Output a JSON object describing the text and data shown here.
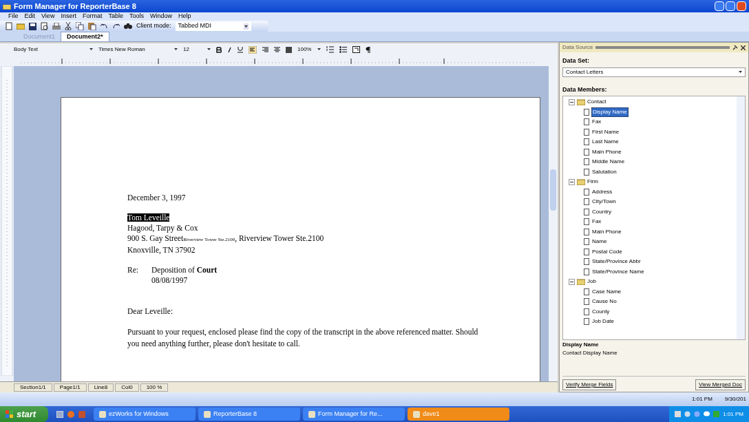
{
  "window": {
    "title": "Form Manager for ReporterBase 8"
  },
  "menu": [
    "File",
    "Edit",
    "View",
    "Insert",
    "Format",
    "Table",
    "Tools",
    "Window",
    "Help"
  ],
  "toolbar": {
    "client_mode_label": "Client mode:",
    "client_mode": "Tabbed MDI"
  },
  "tabs": [
    {
      "label": "Document1",
      "selected": false
    },
    {
      "label": "Document2*",
      "selected": true
    }
  ],
  "format_bar": {
    "style": "Body Text",
    "font": "Times New Roman",
    "size": "12",
    "zoom": "100%"
  },
  "document": {
    "date": "December 3, 1997",
    "name": "Tom Leveille",
    "company": "Hagood, Tarpy & Cox",
    "street": "900 S. Gay Street",
    "street_small": "Riverview Tower Ste.2100",
    "street_rest": ", Riverview Tower Ste.2100",
    "city": "Knoxville, TN  37902",
    "re_label": "Re:",
    "re_text": "Deposition of **Court**",
    "re_date": "08/08/1997",
    "salutation": "Dear Leveille:",
    "body": "Pursuant to your request, enclosed please find the copy of the transcript in the above referenced matter.  Should you need anything further, please don't hesitate to call."
  },
  "status_bar": [
    "Section1/1",
    "Page1/1",
    "Line8",
    "Col0",
    "100 %"
  ],
  "panel": {
    "title": "Data Source",
    "data_set_label": "Data Set:",
    "data_set": "Contact Letters",
    "members_label": "Data Members:",
    "tree": [
      {
        "label": "Contact",
        "expanded": true,
        "children": [
          {
            "label": "Display Name",
            "selected": true
          },
          {
            "label": "Fax",
            "selected": false
          },
          {
            "label": "First Name",
            "selected": false
          },
          {
            "label": "Last Name",
            "selected": false
          },
          {
            "label": "Main Phone",
            "selected": false
          },
          {
            "label": "Middle Name",
            "selected": false
          },
          {
            "label": "Salutation",
            "selected": false
          }
        ]
      },
      {
        "label": "Firm",
        "expanded": true,
        "children": [
          {
            "label": "Address",
            "selected": false
          },
          {
            "label": "City/Town",
            "selected": false
          },
          {
            "label": "Country",
            "selected": false
          },
          {
            "label": "Fax",
            "selected": false
          },
          {
            "label": "Main Phone",
            "selected": false
          },
          {
            "label": "Name",
            "selected": false
          },
          {
            "label": "Postal Code",
            "selected": false
          },
          {
            "label": "State/Province Abbr",
            "selected": false
          },
          {
            "label": "State/Province Name",
            "selected": false
          }
        ]
      },
      {
        "label": "Job",
        "expanded": true,
        "children": [
          {
            "label": "Case Name",
            "selected": false
          },
          {
            "label": "Cause No",
            "selected": false
          },
          {
            "label": "County",
            "selected": false
          },
          {
            "label": "Job Date",
            "selected": false
          }
        ]
      }
    ],
    "desc_title": "Display Name",
    "desc_text": "Contact Display Name",
    "buttons": [
      "Verify Merge Fields",
      "View Merged Doc"
    ]
  },
  "clock_strip": [
    "1:01 PM",
    "9/30/201"
  ],
  "taskbar": {
    "start": "start",
    "tasks": [
      {
        "label": "ezWorks for Windows",
        "flashing": false
      },
      {
        "label": "ReporterBase 8",
        "flashing": false
      },
      {
        "label": "Form Manager for Re...",
        "flashing": false
      },
      {
        "label": "dave1",
        "flashing": true
      }
    ],
    "clock": "1:01 PM"
  }
}
